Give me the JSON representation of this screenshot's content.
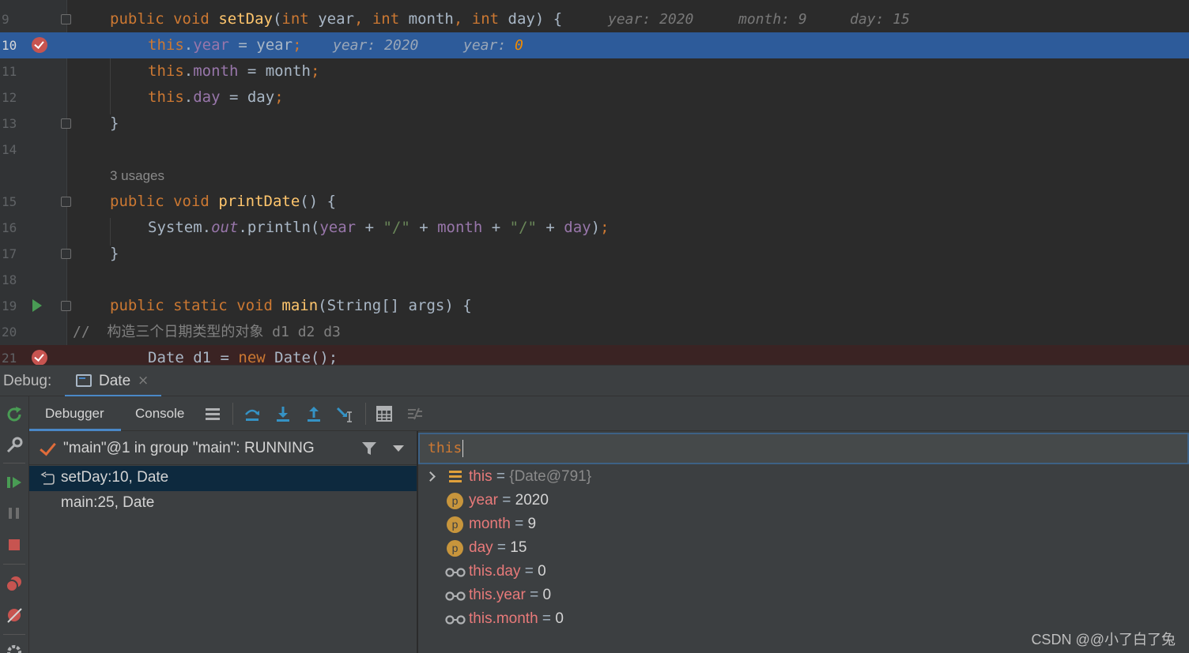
{
  "editor": {
    "lines": [
      {
        "num": "9"
      },
      {
        "num": "10"
      },
      {
        "num": "11"
      },
      {
        "num": "12"
      },
      {
        "num": "13"
      },
      {
        "num": "14"
      },
      {
        "num": "15"
      },
      {
        "num": "16"
      },
      {
        "num": "17"
      },
      {
        "num": "18"
      },
      {
        "num": "19"
      },
      {
        "num": "20"
      },
      {
        "num": "21"
      }
    ],
    "code": {
      "l9_public": "public",
      "l9_void": "void",
      "l9_fn": "setDay",
      "l9_open": "(",
      "l9_int1": "int",
      "l9_year": "year",
      "l9_c1": ",",
      "l9_int2": "int",
      "l9_month": "month",
      "l9_c2": ",",
      "l9_int3": "int",
      "l9_day": "day",
      "l9_close": ") {",
      "l10_this": "this",
      "l10_dot": ".",
      "l10_field": "year",
      "l10_assign": " = year",
      "l10_semi": ";",
      "l11_this": "this",
      "l11_dot": ".",
      "l11_field": "month",
      "l11_assign": " = month",
      "l11_semi": ";",
      "l12_this": "this",
      "l12_dot": ".",
      "l12_field": "day",
      "l12_assign": " = day",
      "l12_semi": ";",
      "l13": "}",
      "usages": "3 usages",
      "l15_public": "public",
      "l15_void": "void",
      "l15_fn": "printDate",
      "l15_rest": "() {",
      "l16_sys": "System.",
      "l16_out": "out",
      "l16_println": ".println(",
      "l16_year": "year",
      "l16_p1": " + ",
      "l16_s1": "\"/\"",
      "l16_p2": " + ",
      "l16_month": "month",
      "l16_p3": " + ",
      "l16_s2": "\"/\"",
      "l16_p4": " + ",
      "l16_day": "day",
      "l16_close": ")",
      "l16_semi": ";",
      "l17": "}",
      "l19_public": "public",
      "l19_static": "static",
      "l19_void": "void",
      "l19_fn": "main",
      "l19_rest": "(String[] args) {",
      "l20_comment": "//  构造三个日期类型的对象 d1 d2 d3",
      "l21_a": "Date d1 = ",
      "l21_new": "new",
      "l21_b": " Date();"
    },
    "hints": {
      "l9_year": "year: 2020",
      "l9_month": "month: 9",
      "l9_day": "day: 15",
      "l10_year": "year: 2020",
      "l10_this_year_label": "year: ",
      "l10_this_year_val": "0"
    }
  },
  "debug": {
    "label": "Debug:",
    "tab_label": "Date",
    "tab_close": "×",
    "tabs": {
      "debugger": "Debugger",
      "console": "Console"
    },
    "thread": "\"main\"@1 in group \"main\": RUNNING",
    "frames": [
      {
        "label": "setDay:10, Date"
      },
      {
        "label": "main:25, Date"
      }
    ],
    "eval_input": "this",
    "variables": [
      {
        "name": "this",
        "eq": " = ",
        "value": "{Date@791}"
      },
      {
        "name": "year",
        "eq": " = ",
        "value": "2020"
      },
      {
        "name": "month",
        "eq": " = ",
        "value": "9"
      },
      {
        "name": "day",
        "eq": " = ",
        "value": "15"
      },
      {
        "name": "this.day",
        "eq": " = ",
        "value": "0"
      },
      {
        "name": "this.year",
        "eq": " = ",
        "value": "0"
      },
      {
        "name": "this.month",
        "eq": " = ",
        "value": "0"
      }
    ],
    "p_icon": "p"
  },
  "watermark": "CSDN @@小了白了兔",
  "colors": {
    "accent": "#4a88c7",
    "exec_line": "#2d5b9a",
    "breakpoint": "#c75450",
    "keyword": "#cc7832",
    "function": "#ffc66d",
    "field": "#9876aa",
    "string": "#6a8759"
  },
  "icons": {
    "toolbar": [
      "rerun-icon",
      "settings-wrench-icon",
      "resume-icon",
      "pause-icon",
      "stop-icon",
      "view-breakpoints-icon",
      "mute-breakpoints-icon",
      "settings-gear-icon"
    ],
    "debugger_toolbar": [
      "frames-layout-icon",
      "step-over-icon",
      "step-into-icon",
      "step-out-icon",
      "run-to-cursor-icon",
      "evaluate-expression-icon",
      "trace-icon"
    ]
  }
}
